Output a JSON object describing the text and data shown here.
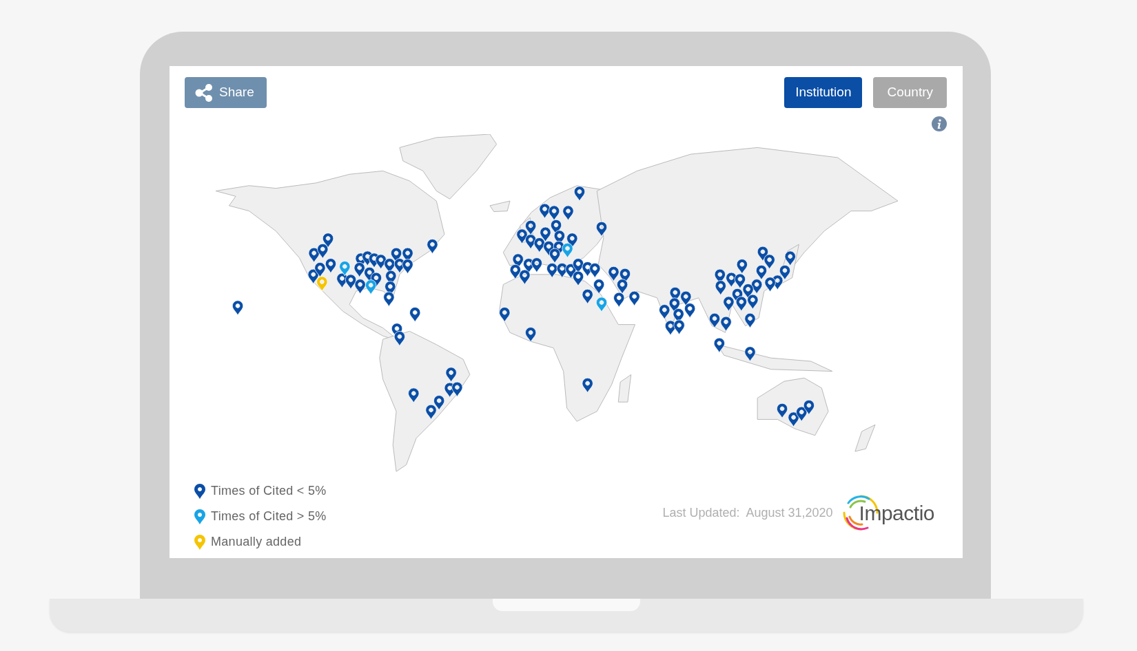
{
  "toolbar": {
    "share_button": "Share",
    "view_tabs": [
      {
        "label": "Institution",
        "selected": true
      },
      {
        "label": "Country",
        "selected": false
      }
    ]
  },
  "legend": [
    {
      "label": "Times of Cited < 5%",
      "color": "#0a4ea6"
    },
    {
      "label": "Times of Cited > 5%",
      "color": "#18a4e6"
    },
    {
      "label": "Manually added",
      "color": "#f5c400"
    }
  ],
  "footer": {
    "last_updated_label": "Last Updated:",
    "last_updated_date": "August 31,2020",
    "logo_text": "Impactio"
  }
}
